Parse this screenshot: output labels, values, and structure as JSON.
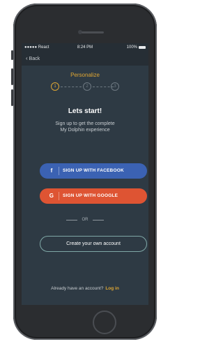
{
  "status_bar": {
    "carrier": "●●●●● React",
    "time": "8:24 PM",
    "battery_percent": "100%"
  },
  "nav": {
    "back_label": "Back"
  },
  "personalize": {
    "title": "Personalize",
    "steps": [
      "1",
      "2",
      "3"
    ],
    "current_step": 1
  },
  "intro": {
    "heading": "Lets start!",
    "subtext_line1": "Sign up to get the complete",
    "subtext_line2": "My Dolphin experience"
  },
  "buttons": {
    "facebook_icon": "f",
    "facebook_label": "SIGN UP WITH FACEBOOK",
    "google_icon": "G",
    "google_label": "SIGN UP WITH GOOGLE",
    "or_label": "OR",
    "create_account_label": "Create your own account"
  },
  "login": {
    "prompt": "Already have an account?",
    "link_label": "Log in"
  },
  "colors": {
    "accent": "#e0a733",
    "facebook": "#3b62b3",
    "google": "#de5433",
    "screen_bg": "#2e3a44"
  }
}
